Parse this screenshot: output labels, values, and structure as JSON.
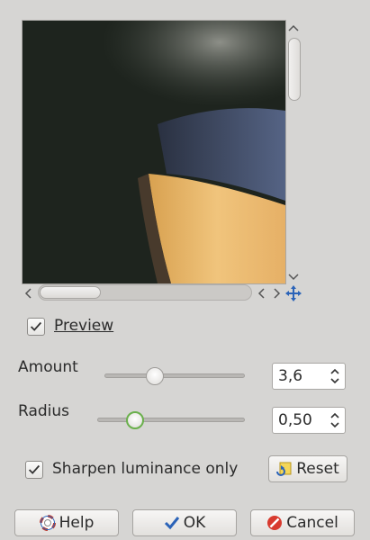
{
  "preview": {
    "label": "Preview",
    "checked": true
  },
  "amount": {
    "label": "Amount",
    "value": "3,6",
    "slider_level": 0.36
  },
  "radius": {
    "label": "Radius",
    "value": "0,50",
    "slider_level": 0.25
  },
  "sharpen_luminance": {
    "label": "Sharpen luminance only",
    "checked": true
  },
  "buttons": {
    "reset": "Reset",
    "help": "Help",
    "ok": "OK",
    "cancel": "Cancel"
  },
  "icons": {
    "reset": "reset-icon",
    "help": "help-icon",
    "ok": "check-icon",
    "cancel": "cancel-icon",
    "navigate": "move-navigate-icon"
  },
  "colors": {
    "focus": "#6ab04c",
    "background": "#d6d5d3"
  }
}
